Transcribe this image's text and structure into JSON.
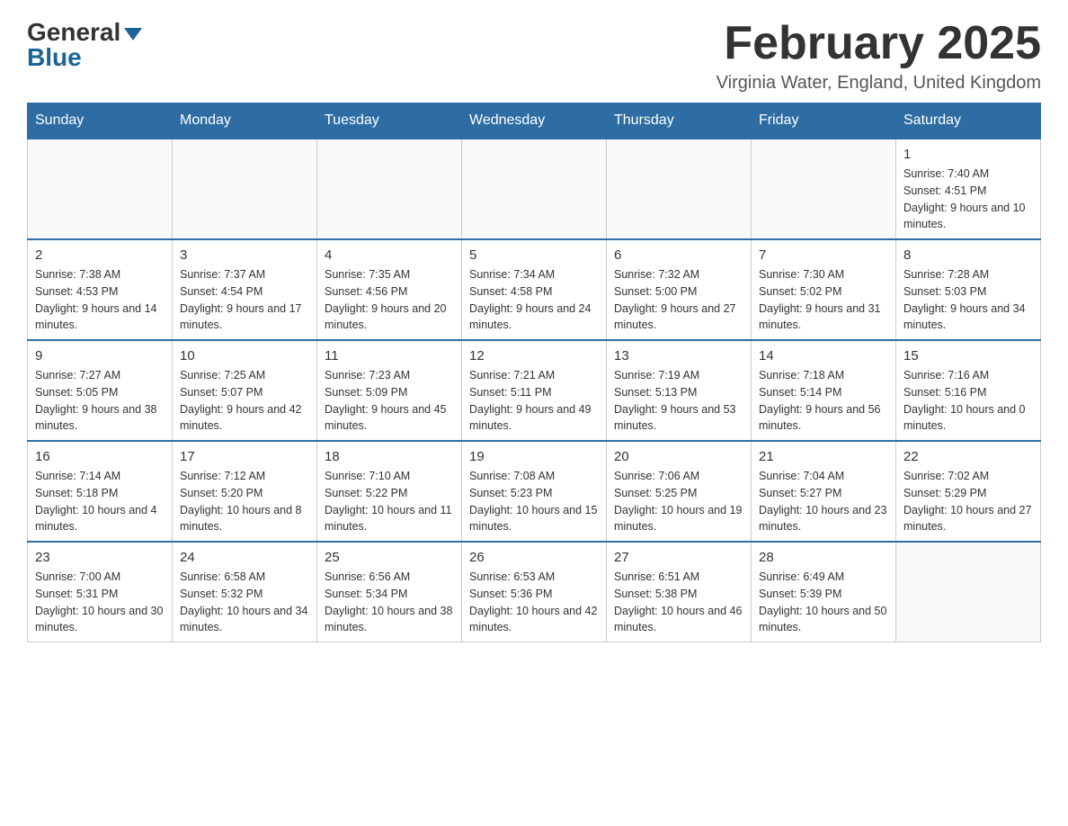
{
  "header": {
    "logo_general": "General",
    "logo_blue": "Blue",
    "title": "February 2025",
    "subtitle": "Virginia Water, England, United Kingdom"
  },
  "days_of_week": [
    "Sunday",
    "Monday",
    "Tuesday",
    "Wednesday",
    "Thursday",
    "Friday",
    "Saturday"
  ],
  "weeks": [
    [
      {
        "day": "",
        "info": ""
      },
      {
        "day": "",
        "info": ""
      },
      {
        "day": "",
        "info": ""
      },
      {
        "day": "",
        "info": ""
      },
      {
        "day": "",
        "info": ""
      },
      {
        "day": "",
        "info": ""
      },
      {
        "day": "1",
        "info": "Sunrise: 7:40 AM\nSunset: 4:51 PM\nDaylight: 9 hours and 10 minutes."
      }
    ],
    [
      {
        "day": "2",
        "info": "Sunrise: 7:38 AM\nSunset: 4:53 PM\nDaylight: 9 hours and 14 minutes."
      },
      {
        "day": "3",
        "info": "Sunrise: 7:37 AM\nSunset: 4:54 PM\nDaylight: 9 hours and 17 minutes."
      },
      {
        "day": "4",
        "info": "Sunrise: 7:35 AM\nSunset: 4:56 PM\nDaylight: 9 hours and 20 minutes."
      },
      {
        "day": "5",
        "info": "Sunrise: 7:34 AM\nSunset: 4:58 PM\nDaylight: 9 hours and 24 minutes."
      },
      {
        "day": "6",
        "info": "Sunrise: 7:32 AM\nSunset: 5:00 PM\nDaylight: 9 hours and 27 minutes."
      },
      {
        "day": "7",
        "info": "Sunrise: 7:30 AM\nSunset: 5:02 PM\nDaylight: 9 hours and 31 minutes."
      },
      {
        "day": "8",
        "info": "Sunrise: 7:28 AM\nSunset: 5:03 PM\nDaylight: 9 hours and 34 minutes."
      }
    ],
    [
      {
        "day": "9",
        "info": "Sunrise: 7:27 AM\nSunset: 5:05 PM\nDaylight: 9 hours and 38 minutes."
      },
      {
        "day": "10",
        "info": "Sunrise: 7:25 AM\nSunset: 5:07 PM\nDaylight: 9 hours and 42 minutes."
      },
      {
        "day": "11",
        "info": "Sunrise: 7:23 AM\nSunset: 5:09 PM\nDaylight: 9 hours and 45 minutes."
      },
      {
        "day": "12",
        "info": "Sunrise: 7:21 AM\nSunset: 5:11 PM\nDaylight: 9 hours and 49 minutes."
      },
      {
        "day": "13",
        "info": "Sunrise: 7:19 AM\nSunset: 5:13 PM\nDaylight: 9 hours and 53 minutes."
      },
      {
        "day": "14",
        "info": "Sunrise: 7:18 AM\nSunset: 5:14 PM\nDaylight: 9 hours and 56 minutes."
      },
      {
        "day": "15",
        "info": "Sunrise: 7:16 AM\nSunset: 5:16 PM\nDaylight: 10 hours and 0 minutes."
      }
    ],
    [
      {
        "day": "16",
        "info": "Sunrise: 7:14 AM\nSunset: 5:18 PM\nDaylight: 10 hours and 4 minutes."
      },
      {
        "day": "17",
        "info": "Sunrise: 7:12 AM\nSunset: 5:20 PM\nDaylight: 10 hours and 8 minutes."
      },
      {
        "day": "18",
        "info": "Sunrise: 7:10 AM\nSunset: 5:22 PM\nDaylight: 10 hours and 11 minutes."
      },
      {
        "day": "19",
        "info": "Sunrise: 7:08 AM\nSunset: 5:23 PM\nDaylight: 10 hours and 15 minutes."
      },
      {
        "day": "20",
        "info": "Sunrise: 7:06 AM\nSunset: 5:25 PM\nDaylight: 10 hours and 19 minutes."
      },
      {
        "day": "21",
        "info": "Sunrise: 7:04 AM\nSunset: 5:27 PM\nDaylight: 10 hours and 23 minutes."
      },
      {
        "day": "22",
        "info": "Sunrise: 7:02 AM\nSunset: 5:29 PM\nDaylight: 10 hours and 27 minutes."
      }
    ],
    [
      {
        "day": "23",
        "info": "Sunrise: 7:00 AM\nSunset: 5:31 PM\nDaylight: 10 hours and 30 minutes."
      },
      {
        "day": "24",
        "info": "Sunrise: 6:58 AM\nSunset: 5:32 PM\nDaylight: 10 hours and 34 minutes."
      },
      {
        "day": "25",
        "info": "Sunrise: 6:56 AM\nSunset: 5:34 PM\nDaylight: 10 hours and 38 minutes."
      },
      {
        "day": "26",
        "info": "Sunrise: 6:53 AM\nSunset: 5:36 PM\nDaylight: 10 hours and 42 minutes."
      },
      {
        "day": "27",
        "info": "Sunrise: 6:51 AM\nSunset: 5:38 PM\nDaylight: 10 hours and 46 minutes."
      },
      {
        "day": "28",
        "info": "Sunrise: 6:49 AM\nSunset: 5:39 PM\nDaylight: 10 hours and 50 minutes."
      },
      {
        "day": "",
        "info": ""
      }
    ]
  ]
}
